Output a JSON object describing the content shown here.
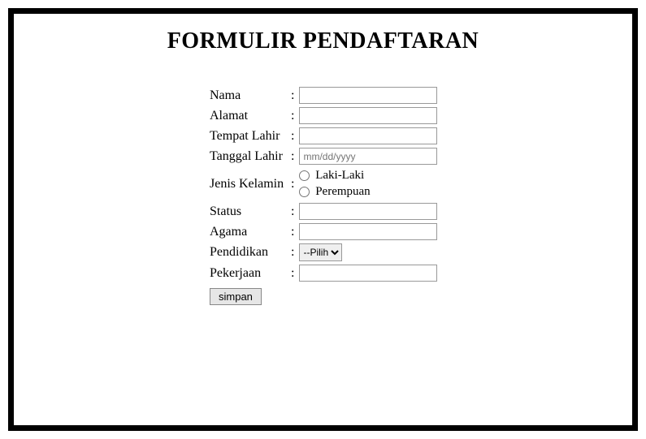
{
  "title": "FORMULIR PENDAFTARAN",
  "form": {
    "fields": {
      "nama": {
        "label": "Nama",
        "value": ""
      },
      "alamat": {
        "label": "Alamat",
        "value": ""
      },
      "tempat_lahir": {
        "label": "Tempat Lahir",
        "value": ""
      },
      "tanggal_lahir": {
        "label": "Tanggal Lahir",
        "placeholder": "mm/dd/yyyy",
        "value": ""
      },
      "jenis_kelamin": {
        "label": "Jenis Kelamin",
        "options": [
          {
            "label": "Laki-Laki"
          },
          {
            "label": "Perempuan"
          }
        ]
      },
      "status": {
        "label": "Status",
        "value": ""
      },
      "agama": {
        "label": "Agama",
        "value": ""
      },
      "pendidikan": {
        "label": "Pendidikan",
        "selected": "--Pilih"
      },
      "pekerjaan": {
        "label": "Pekerjaan",
        "value": ""
      }
    },
    "submit_label": "simpan",
    "colon": ":"
  }
}
